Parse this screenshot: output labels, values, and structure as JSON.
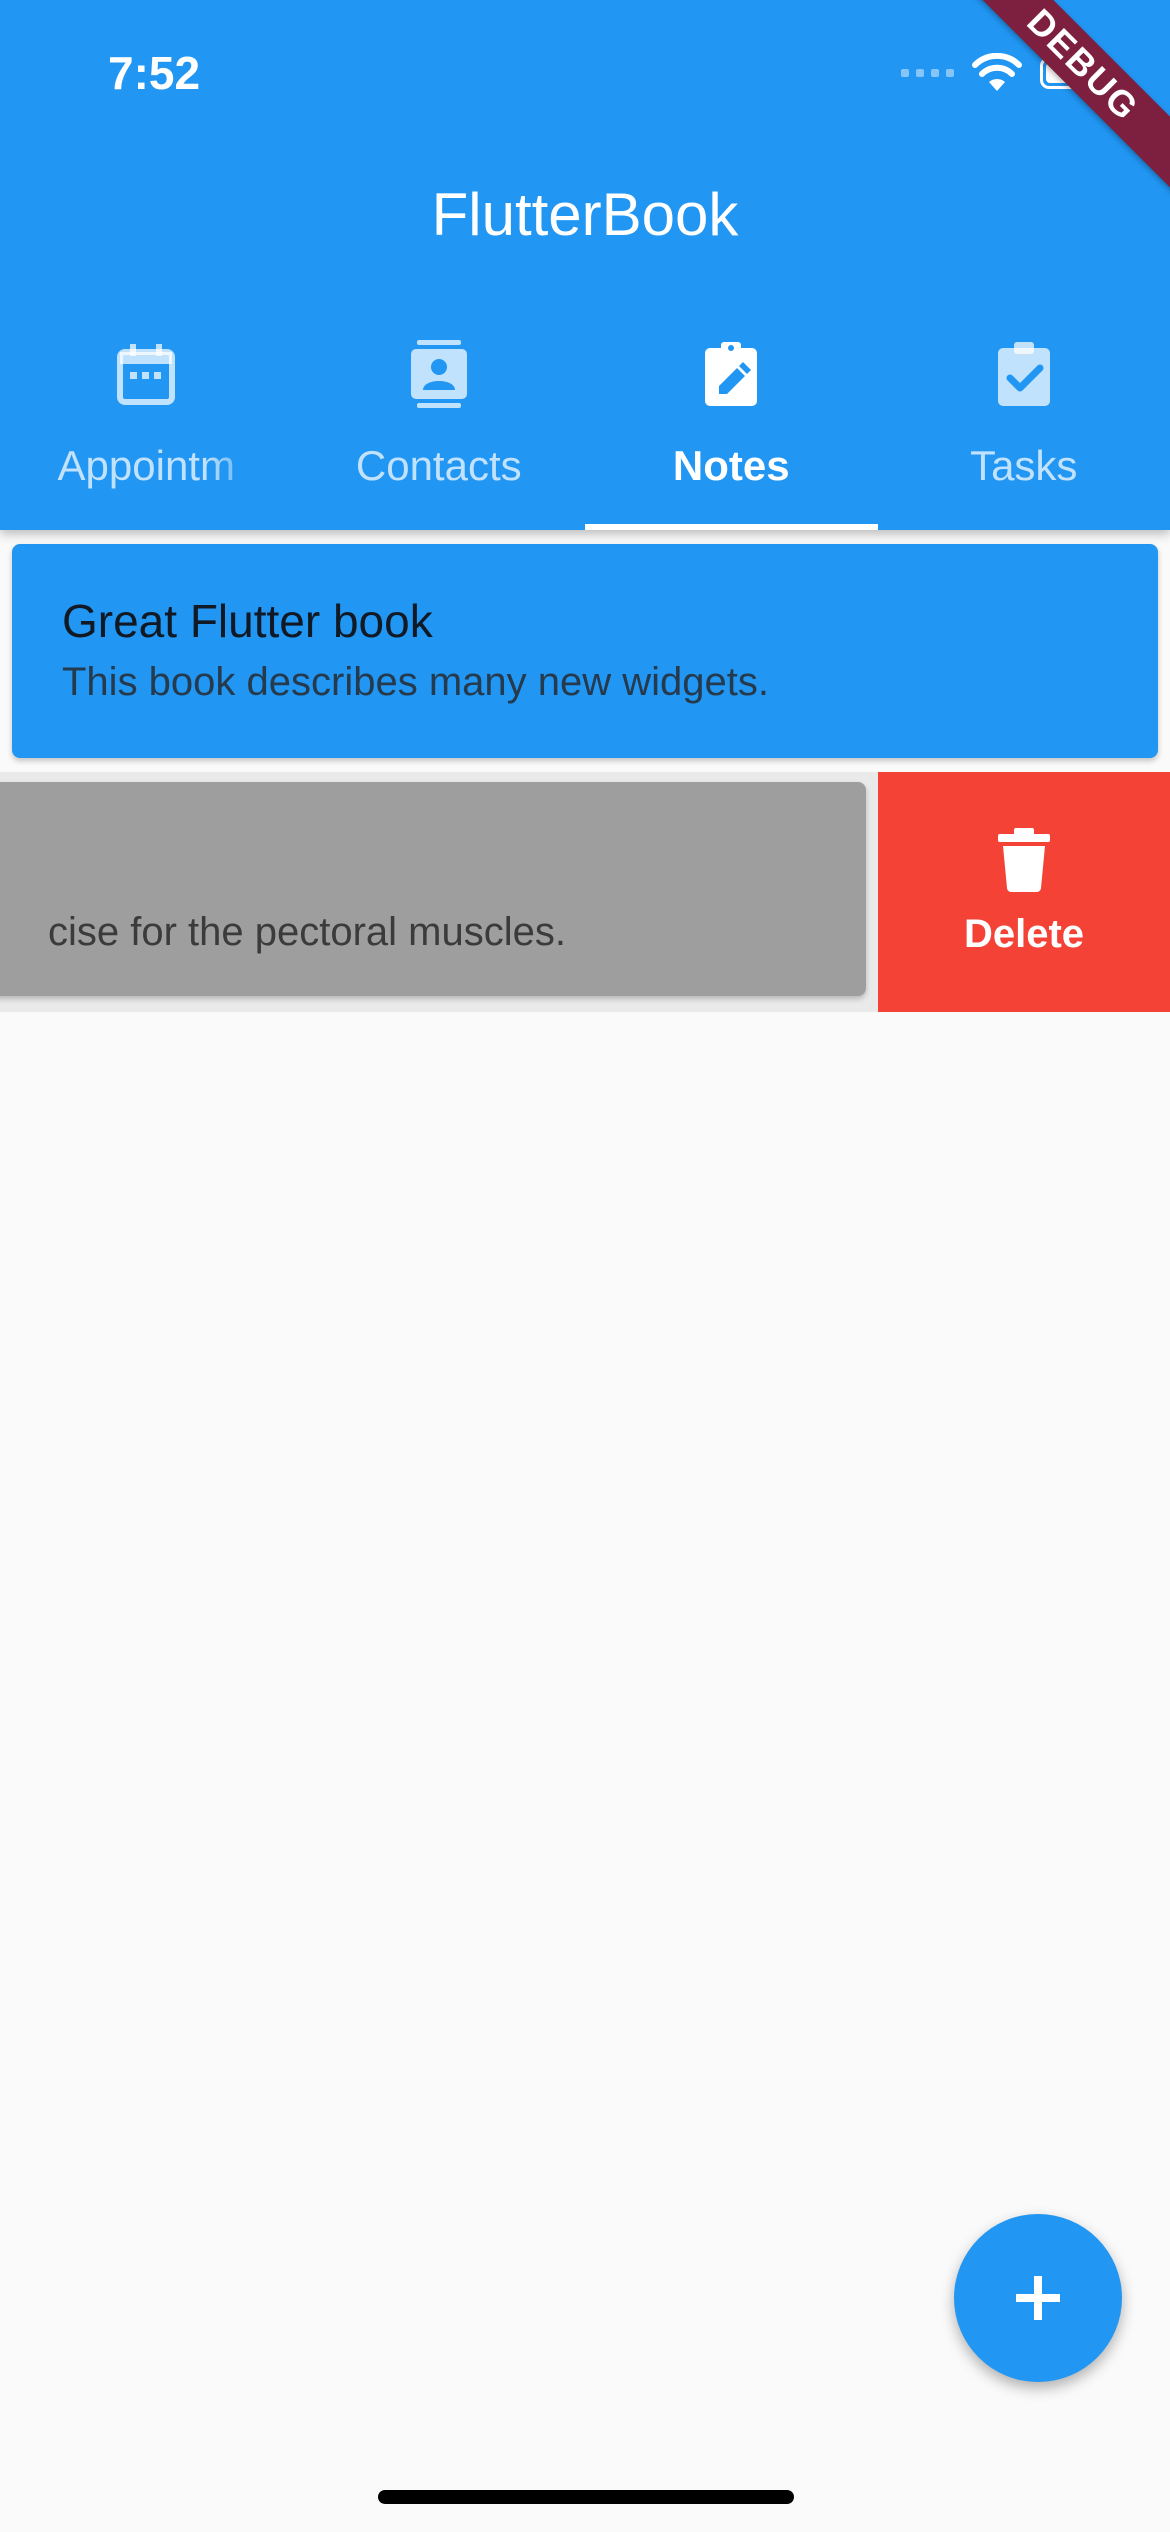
{
  "status_bar": {
    "time": "7:52",
    "icons": [
      "signal-icon",
      "wifi-icon",
      "battery-icon"
    ]
  },
  "debug_banner": "DEBUG",
  "app_bar": {
    "title": "FlutterBook"
  },
  "tabs": [
    {
      "label": "Appointm",
      "icon": "calendar-icon",
      "active": false
    },
    {
      "label": "Contacts",
      "icon": "contact-card-icon",
      "active": false
    },
    {
      "label": "Notes",
      "icon": "note-edit-icon",
      "active": true
    },
    {
      "label": "Tasks",
      "icon": "clipboard-check-icon",
      "active": false
    }
  ],
  "notes": [
    {
      "title": "Great Flutter book",
      "content": "This book describes many new widgets."
    },
    {
      "title": "",
      "content": "cise for the pectoral muscles."
    }
  ],
  "slide_action": {
    "label": "Delete",
    "icon": "trash-icon"
  },
  "fab": {
    "icon": "plus-icon"
  },
  "colors": {
    "primary": "#2196f3",
    "delete": "#f44336",
    "card_grey": "#9e9e9e",
    "background": "#fafafa",
    "debug": "#7d1f3e"
  }
}
